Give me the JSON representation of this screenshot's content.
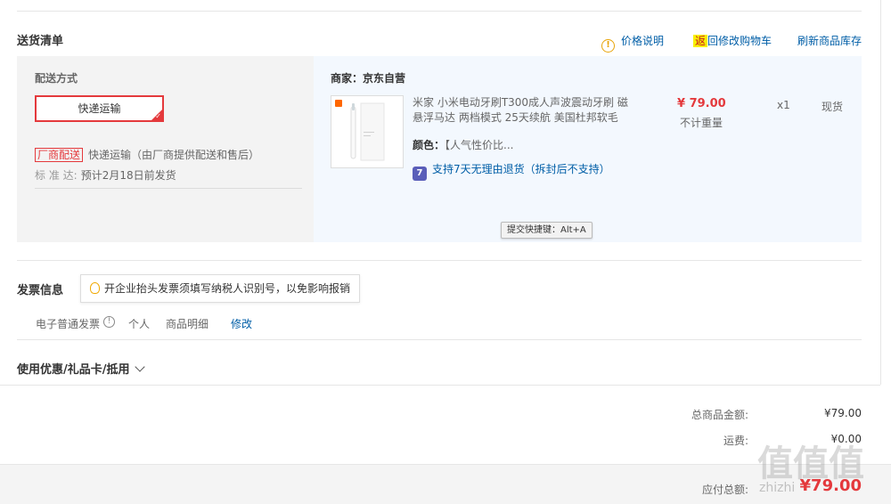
{
  "delivery": {
    "title": "送货清单",
    "links": {
      "price_note": "价格说明",
      "return_badge": "返",
      "back_to_cart": "回修改购物车",
      "refresh_stock": "刷新商品库存"
    },
    "shipping": {
      "label": "配送方式",
      "method_button": "快递运输",
      "vendor_tag": "厂商配送",
      "vendor_text": "快递运输（由厂商提供配送和售后）",
      "eta_label": "标 准 达:",
      "eta_value": "预计2月18日前发货"
    },
    "merchant": "商家：京东自营",
    "product": {
      "name": "米家 小米电动牙刷T300成人声波震动牙刷 磁悬浮马达 两档模式 25天续航 美国杜邦软毛",
      "color_label": "颜色：",
      "color_value": "【人气性价比...",
      "return_badge": "7",
      "return_text": "支持7天无理由退货（拆封后不支持）",
      "price": "¥ 79.00",
      "weight": "不计重量",
      "quantity": "x1",
      "stock": "现货"
    },
    "tooltip": "提交快捷键：Alt+A"
  },
  "invoice": {
    "title": "发票信息",
    "tip": "开企业抬头发票须填写纳税人识别号，以免影响报销",
    "type": "电子普通发票",
    "info_glyph": "!",
    "person": "个人",
    "detail": "商品明细",
    "modify": "修改"
  },
  "coupon": {
    "title": "使用优惠/礼品卡/抵用"
  },
  "summary": {
    "goods_label": "总商品金额:",
    "goods_value": "¥79.00",
    "freight_label": "运费:",
    "freight_value": "¥0.00",
    "total_label": "应付总额:",
    "total_value": "¥79.00"
  },
  "watermark": {
    "logo": "值值值",
    "site": "zhizhi"
  },
  "colors": {
    "accent_red": "#e4393c",
    "link_blue": "#005ea7",
    "panel_blue": "#f3f8fe"
  }
}
